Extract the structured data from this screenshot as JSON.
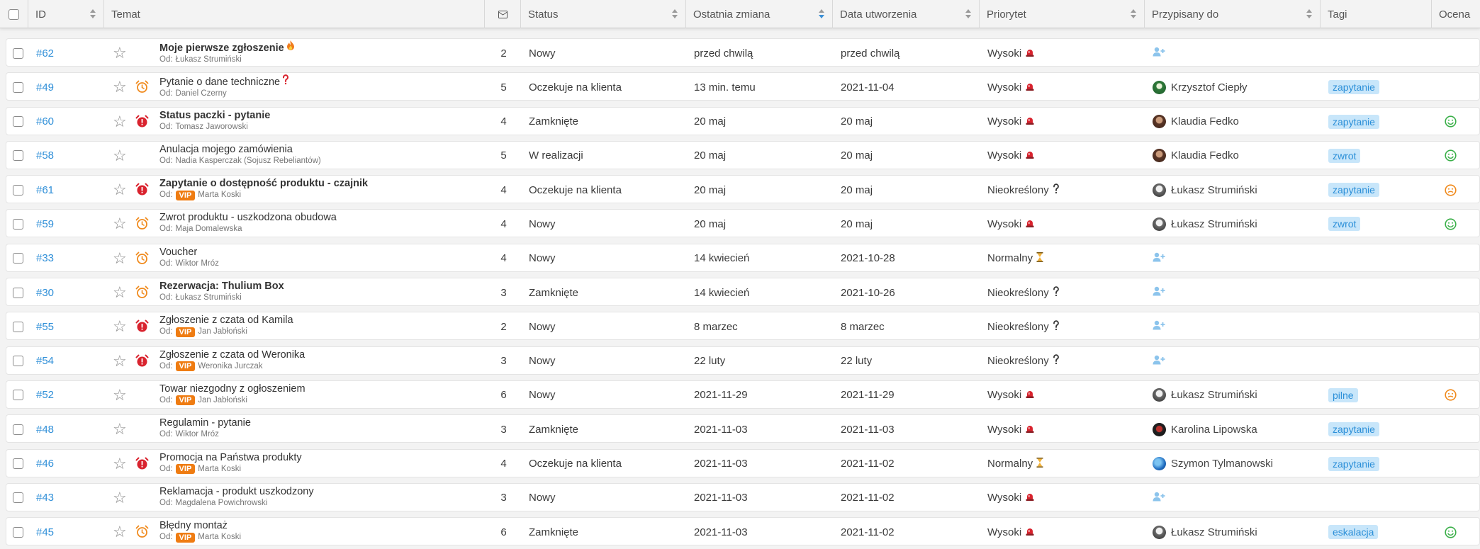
{
  "columns": {
    "id": "ID",
    "temat": "Temat",
    "status": "Status",
    "ostatnia_zmiana": "Ostatnia zmiana",
    "data_utworzenia": "Data utworzenia",
    "priorytet": "Priorytet",
    "przypisany": "Przypisany do",
    "tagi": "Tagi",
    "ocena": "Ocena"
  },
  "from_prefix": "Od:",
  "vip_label": "VIP",
  "colors": {
    "accent": "#2f8fd8",
    "vip": "#ef7c12",
    "alarm_orange": "#f08a1c",
    "alarm_red": "#d9232e",
    "tag_bg": "#c8e6fa",
    "face_green": "#3cb04a",
    "face_orange": "#f08a1c"
  },
  "tickets": [
    {
      "id": "#62",
      "title": "Moje pierwsze zgłoszenie",
      "bold": true,
      "emoji": "fire-icon",
      "from": "Łukasz Strumiński",
      "vip": false,
      "alarm": "none",
      "messages": "2",
      "status": "Nowy",
      "last_change": "przed chwilą",
      "created": "przed chwilą",
      "priority": "Wysoki",
      "priority_icon": "siren-icon",
      "assignee": "",
      "avatar": "none",
      "tag": "",
      "rating": "none"
    },
    {
      "id": "#49",
      "title": "Pytanie o dane techniczne",
      "bold": false,
      "emoji": "question-icon",
      "from": "Daniel Czerny",
      "vip": false,
      "alarm": "orange",
      "messages": "5",
      "status": "Oczekuje na klienta",
      "last_change": "13 min. temu",
      "created": "2021-11-04",
      "priority": "Wysoki",
      "priority_icon": "siren-icon",
      "assignee": "Krzysztof Ciepły",
      "avatar": "green",
      "tag": "zapytanie",
      "rating": "none"
    },
    {
      "id": "#60",
      "title": "Status paczki - pytanie",
      "bold": true,
      "emoji": "",
      "from": "Tomasz Jaworowski",
      "vip": false,
      "alarm": "red",
      "messages": "4",
      "status": "Zamknięte",
      "last_change": "20 maj",
      "created": "20 maj",
      "priority": "Wysoki",
      "priority_icon": "siren-icon",
      "assignee": "Klaudia Fedko",
      "avatar": "brown",
      "tag": "zapytanie",
      "rating": "positive"
    },
    {
      "id": "#58",
      "title": "Anulacja mojego zamówienia",
      "bold": false,
      "emoji": "",
      "from": "Nadia Kasperczak (Sojusz Rebeliantów)",
      "vip": false,
      "alarm": "none",
      "messages": "5",
      "status": "W realizacji",
      "last_change": "20 maj",
      "created": "20 maj",
      "priority": "Wysoki",
      "priority_icon": "siren-icon",
      "assignee": "Klaudia Fedko",
      "avatar": "brown",
      "tag": "zwrot",
      "rating": "positive"
    },
    {
      "id": "#61",
      "title": "Zapytanie o dostępność produktu - czajnik",
      "bold": true,
      "emoji": "",
      "from": "Marta Koski",
      "vip": true,
      "alarm": "red",
      "messages": "4",
      "status": "Oczekuje na klienta",
      "last_change": "20 maj",
      "created": "20 maj",
      "priority": "Nieokreślony",
      "priority_icon": "question-icon",
      "assignee": "Łukasz Strumiński",
      "avatar": "grey",
      "tag": "zapytanie",
      "rating": "neutral"
    },
    {
      "id": "#59",
      "title": "Zwrot produktu - uszkodzona obudowa",
      "bold": false,
      "emoji": "",
      "from": "Maja Domalewska",
      "vip": false,
      "alarm": "orange",
      "messages": "4",
      "status": "Nowy",
      "last_change": "20 maj",
      "created": "20 maj",
      "priority": "Wysoki",
      "priority_icon": "siren-icon",
      "assignee": "Łukasz Strumiński",
      "avatar": "grey",
      "tag": "zwrot",
      "rating": "positive"
    },
    {
      "id": "#33",
      "title": "Voucher",
      "bold": false,
      "emoji": "",
      "from": "Wiktor Mróz",
      "vip": false,
      "alarm": "orange",
      "messages": "4",
      "status": "Nowy",
      "last_change": "14 kwiecień",
      "created": "2021-10-28",
      "priority": "Normalny",
      "priority_icon": "hourglass-icon",
      "assignee": "",
      "avatar": "none",
      "tag": "",
      "rating": "none"
    },
    {
      "id": "#30",
      "title": "Rezerwacja: Thulium Box",
      "bold": true,
      "emoji": "",
      "from": "Łukasz Strumiński",
      "vip": false,
      "alarm": "orange",
      "messages": "3",
      "status": "Zamknięte",
      "last_change": "14 kwiecień",
      "created": "2021-10-26",
      "priority": "Nieokreślony",
      "priority_icon": "question-icon",
      "assignee": "",
      "avatar": "none",
      "tag": "",
      "rating": "none"
    },
    {
      "id": "#55",
      "title": "Zgłoszenie z czata od Kamila",
      "bold": false,
      "emoji": "",
      "from": "Jan Jabłoński",
      "vip": true,
      "alarm": "red",
      "messages": "2",
      "status": "Nowy",
      "last_change": "8 marzec",
      "created": "8 marzec",
      "priority": "Nieokreślony",
      "priority_icon": "question-icon",
      "assignee": "",
      "avatar": "none",
      "tag": "",
      "rating": "none"
    },
    {
      "id": "#54",
      "title": "Zgłoszenie z czata od Weronika",
      "bold": false,
      "emoji": "",
      "from": "Weronika Jurczak",
      "vip": true,
      "alarm": "red",
      "messages": "3",
      "status": "Nowy",
      "last_change": "22 luty",
      "created": "22 luty",
      "priority": "Nieokreślony",
      "priority_icon": "question-icon",
      "assignee": "",
      "avatar": "none",
      "tag": "",
      "rating": "none"
    },
    {
      "id": "#52",
      "title": "Towar niezgodny z ogłoszeniem",
      "bold": false,
      "emoji": "",
      "from": "Jan Jabłoński",
      "vip": true,
      "alarm": "none",
      "messages": "6",
      "status": "Nowy",
      "last_change": "2021-11-29",
      "created": "2021-11-29",
      "priority": "Wysoki",
      "priority_icon": "siren-icon",
      "assignee": "Łukasz Strumiński",
      "avatar": "grey",
      "tag": "pilne",
      "rating": "neutral"
    },
    {
      "id": "#48",
      "title": "Regulamin - pytanie",
      "bold": false,
      "emoji": "",
      "from": "Wiktor Mróz",
      "vip": false,
      "alarm": "none",
      "messages": "3",
      "status": "Zamknięte",
      "last_change": "2021-11-03",
      "created": "2021-11-03",
      "priority": "Wysoki",
      "priority_icon": "siren-icon",
      "assignee": "Karolina Lipowska",
      "avatar": "dark",
      "tag": "zapytanie",
      "rating": "none"
    },
    {
      "id": "#46",
      "title": "Promocja na Państwa produkty",
      "bold": false,
      "emoji": "",
      "from": "Marta Koski",
      "vip": true,
      "alarm": "red",
      "messages": "4",
      "status": "Oczekuje na klienta",
      "last_change": "2021-11-03",
      "created": "2021-11-02",
      "priority": "Normalny",
      "priority_icon": "hourglass-icon",
      "assignee": "Szymon Tylmanowski",
      "avatar": "blue",
      "tag": "zapytanie",
      "rating": "none"
    },
    {
      "id": "#43",
      "title": "Reklamacja - produkt uszkodzony",
      "bold": false,
      "emoji": "",
      "from": "Magdalena Powichrowski",
      "vip": false,
      "alarm": "none",
      "messages": "3",
      "status": "Nowy",
      "last_change": "2021-11-03",
      "created": "2021-11-02",
      "priority": "Wysoki",
      "priority_icon": "siren-icon",
      "assignee": "",
      "avatar": "none",
      "tag": "",
      "rating": "none"
    },
    {
      "id": "#45",
      "title": "Błędny montaż",
      "bold": false,
      "emoji": "",
      "from": "Marta Koski",
      "vip": true,
      "alarm": "orange",
      "messages": "6",
      "status": "Zamknięte",
      "last_change": "2021-11-03",
      "created": "2021-11-02",
      "priority": "Wysoki",
      "priority_icon": "siren-icon",
      "assignee": "Łukasz Strumiński",
      "avatar": "grey",
      "tag": "eskalacja",
      "rating": "positive"
    }
  ]
}
